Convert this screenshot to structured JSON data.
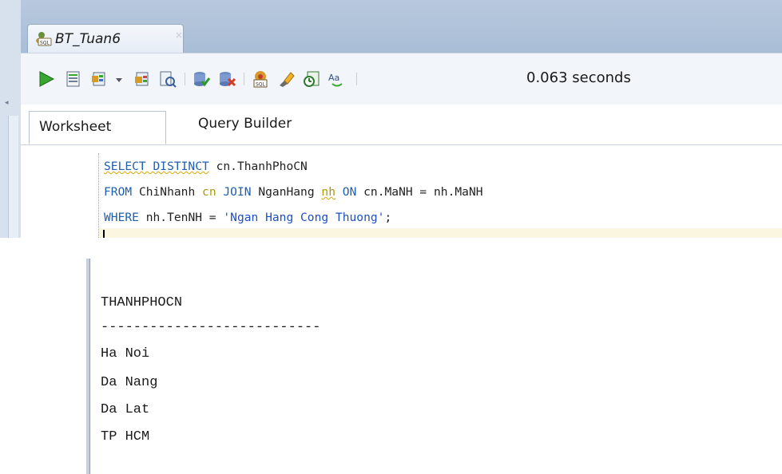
{
  "editor": {
    "tab_title": "BT_Tuan6",
    "tab_close": "×",
    "elapsed": "0.063 seconds",
    "tabs": [
      "Worksheet",
      "Query Builder"
    ],
    "sql": {
      "line1": {
        "kw1": "SELECT DISTINCT",
        "rest": " cn.ThanhPhoCN"
      },
      "line2": {
        "kw1": "FROM",
        "t1": " ChiNhanh ",
        "a1": "cn",
        "kw2": " JOIN",
        "t2": " NganHang ",
        "a2": "nh",
        "kw3": " ON",
        "rest": " cn.MaNH = nh.MaNH"
      },
      "line3": {
        "kw1": "WHERE",
        "rest": " nh.TenNH = ",
        "str": "'Ngan Hang Cong Thuong'",
        "end": ";"
      }
    }
  },
  "output": {
    "column_header": "THANHPHOCN",
    "separator": "---------------------------",
    "rows": [
      "Ha Noi",
      "Da Nang",
      "Da Lat",
      "TP HCM"
    ]
  },
  "icons": {
    "run": "run-statement-icon",
    "script": "run-script-icon",
    "autotrace": "autotrace-icon",
    "explain": "explain-plan-icon",
    "sql_tuning": "sql-tuning-advisor-icon",
    "commit": "commit-icon",
    "rollback": "rollback-icon",
    "unshared": "unshared-sql-worksheet-icon",
    "clear": "clear-eraser-icon",
    "history": "sql-history-icon",
    "format": "to-upper-lower-case-icon"
  }
}
